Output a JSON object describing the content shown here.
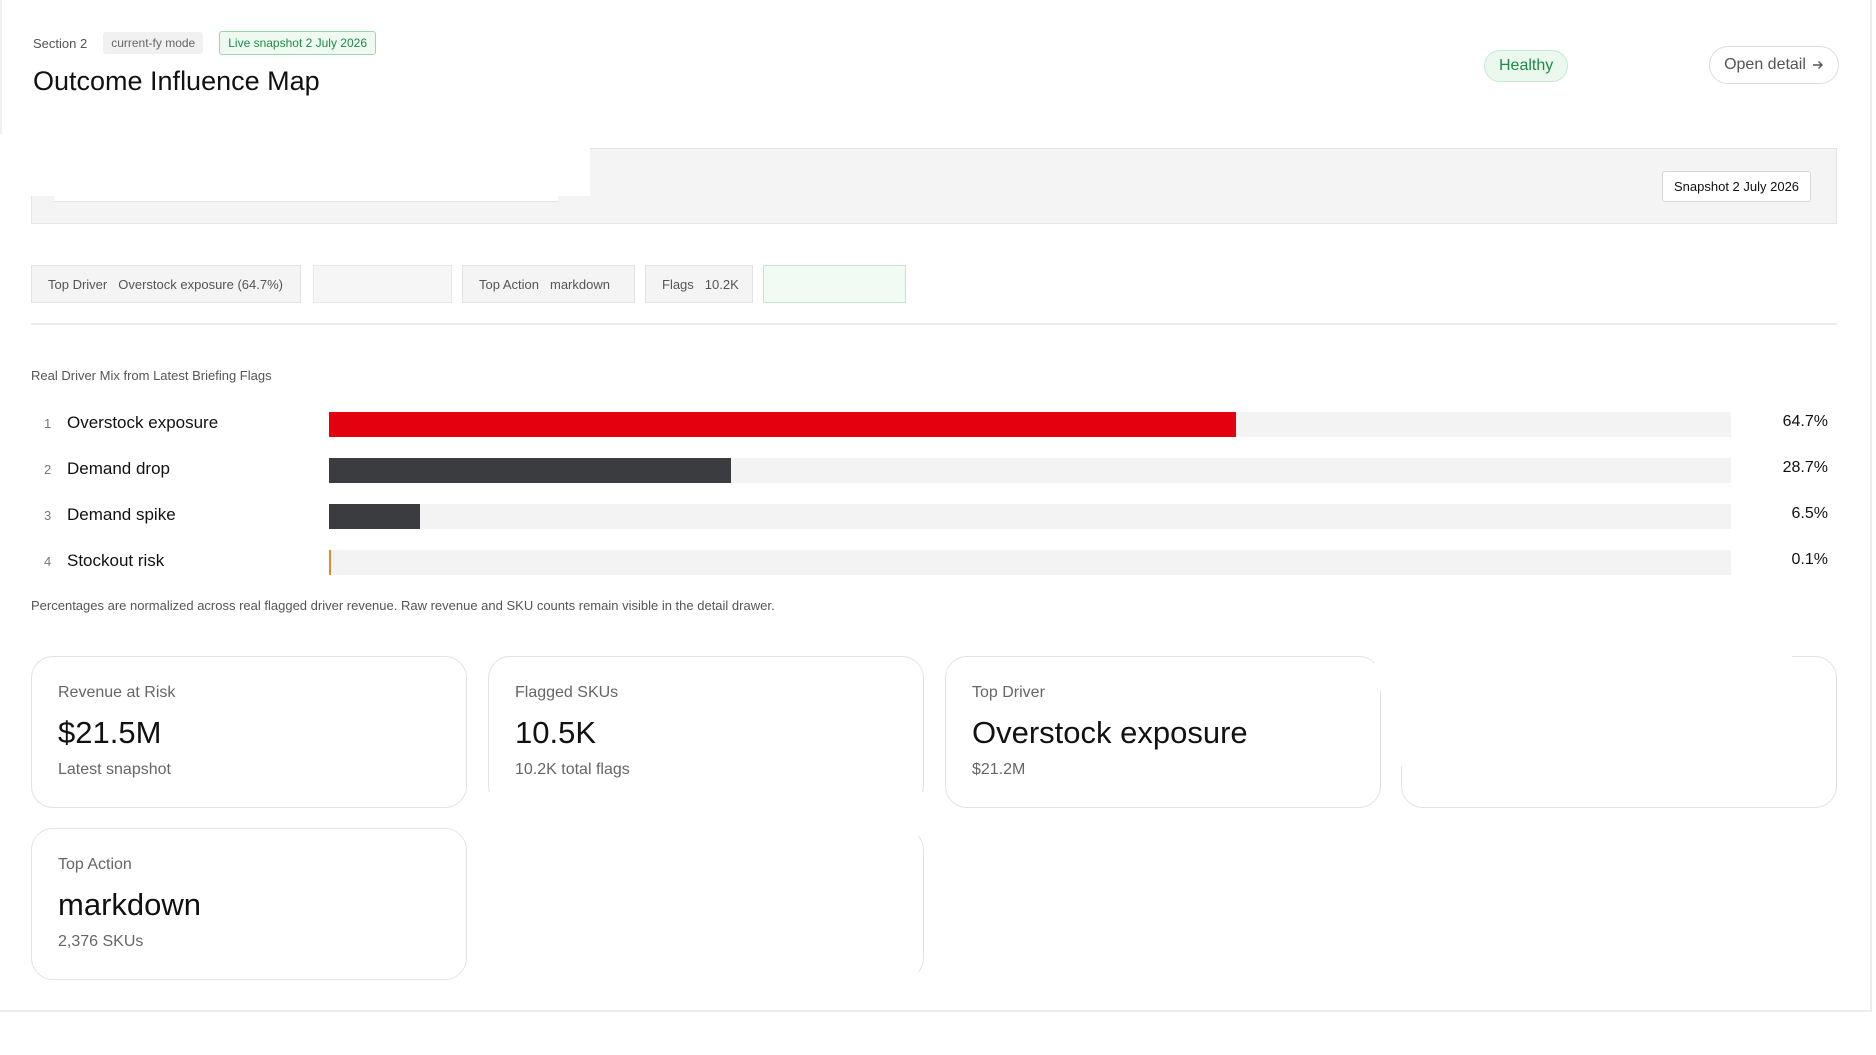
{
  "header": {
    "section": "Section 2",
    "mode": "current-fy mode",
    "live_snapshot": "Live snapshot 2 July 2026",
    "title": "Outcome Influence Map",
    "status": "Healthy",
    "open_detail": "Open detail",
    "open_detail_icon": "arrow-right-icon"
  },
  "snapshot": {
    "badge": "Snapshot 2 July 2026"
  },
  "chips": [
    {
      "label": "Top Driver",
      "value": "Overstock exposure (64.7%)"
    },
    {
      "label": "Top Action",
      "value": "markdown"
    },
    {
      "label": "Flags",
      "value": "10.2K"
    }
  ],
  "driver_mix": {
    "title": "Real Driver Mix from Latest Briefing Flags",
    "footnote": "Percentages are normalized across real flagged driver revenue. Raw revenue and SKU counts remain visible in the detail drawer.",
    "colors": {
      "primary": "#e3000f",
      "secondary": "#3b3c40",
      "tertiary": "#e08a2c",
      "track": "#f3f3f3"
    },
    "rows": [
      {
        "rank": "1",
        "name": "Overstock exposure",
        "pct_label": "64.7%",
        "value": 64.7,
        "color": "#e3000f"
      },
      {
        "rank": "2",
        "name": "Demand drop",
        "pct_label": "28.7%",
        "value": 28.7,
        "color": "#3b3c40"
      },
      {
        "rank": "3",
        "name": "Demand spike",
        "pct_label": "6.5%",
        "value": 6.5,
        "color": "#3b3c40"
      },
      {
        "rank": "4",
        "name": "Stockout risk",
        "pct_label": "0.1%",
        "value": 0.1,
        "color": "#e08a2c"
      }
    ]
  },
  "cards": [
    {
      "label": "Revenue at Risk",
      "value": "$21.5M",
      "sub": "Latest snapshot"
    },
    {
      "label": "Flagged SKUs",
      "value": "10.5K",
      "sub": "10.2K total flags"
    },
    {
      "label": "Top Driver",
      "value": "Overstock exposure",
      "sub": "$21.2M"
    },
    {
      "label": "Top Action",
      "value": "markdown",
      "sub": "2,376 SKUs"
    }
  ]
}
